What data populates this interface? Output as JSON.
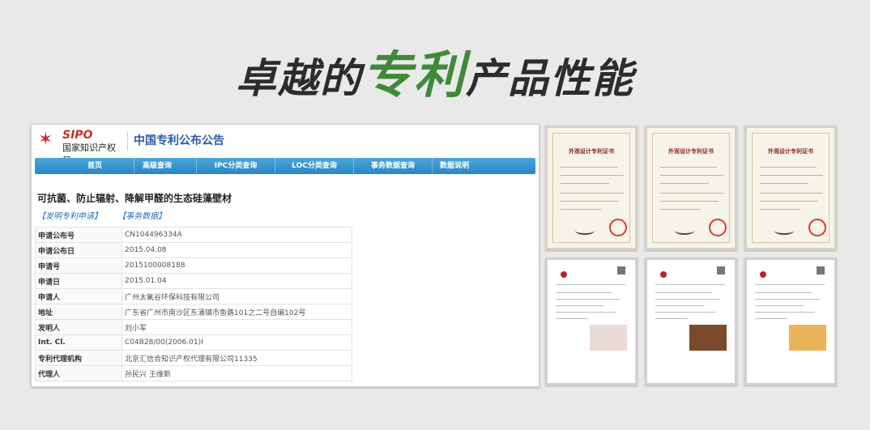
{
  "headline": {
    "part1": "卓越的",
    "accent": "专利",
    "part2": "产品性能"
  },
  "site": {
    "logo_abbr": "SIPO",
    "logo_name": "国家知识产权局",
    "title": "中国专利公布公告"
  },
  "nav": [
    "首页",
    "高级查询",
    "IPC分类查询",
    "LOC分类查询",
    "事务数据查询",
    "数据说明"
  ],
  "patent": {
    "title": "可抗菌、防止辐射、降解甲醛的生态硅藻壁材",
    "links": [
      "【发明专利申请】",
      "【事务数据】"
    ],
    "rows": [
      {
        "label": "申请公布号",
        "value": "CN104496334A"
      },
      {
        "label": "申请公布日",
        "value": "2015.04.08"
      },
      {
        "label": "申请号",
        "value": "2015100008188"
      },
      {
        "label": "申请日",
        "value": "2015.01.04"
      },
      {
        "label": "申请人",
        "value": "广州太氟谷环保科技有限公司"
      },
      {
        "label": "地址",
        "value": "广东省广州市南沙区东涌镇市鱼路101之二号自编102号"
      },
      {
        "label": "发明人",
        "value": "刘小军"
      },
      {
        "label": "Int. Cl.",
        "value": "C04B28/00(2006.01)I"
      },
      {
        "label": "专利代理机构",
        "value": "北京汇信合知识产权代理有限公司11335"
      },
      {
        "label": "代理人",
        "value": "孙民兴  王维新"
      }
    ]
  },
  "certificates": [
    {
      "title": "外观设计专利证书"
    },
    {
      "title": "外观设计专利证书"
    },
    {
      "title": "外观设计专利证书"
    }
  ],
  "documents": [
    {
      "swatch_color": "#eadbd6"
    },
    {
      "swatch_color": "#7a4a2a"
    },
    {
      "swatch_color": "#e9b45a"
    }
  ],
  "colors": {
    "accent_green": "#3f8a3a",
    "nav_blue": "#2b86c5",
    "link_blue": "#2b72b8",
    "seal_red": "#d63b34"
  }
}
